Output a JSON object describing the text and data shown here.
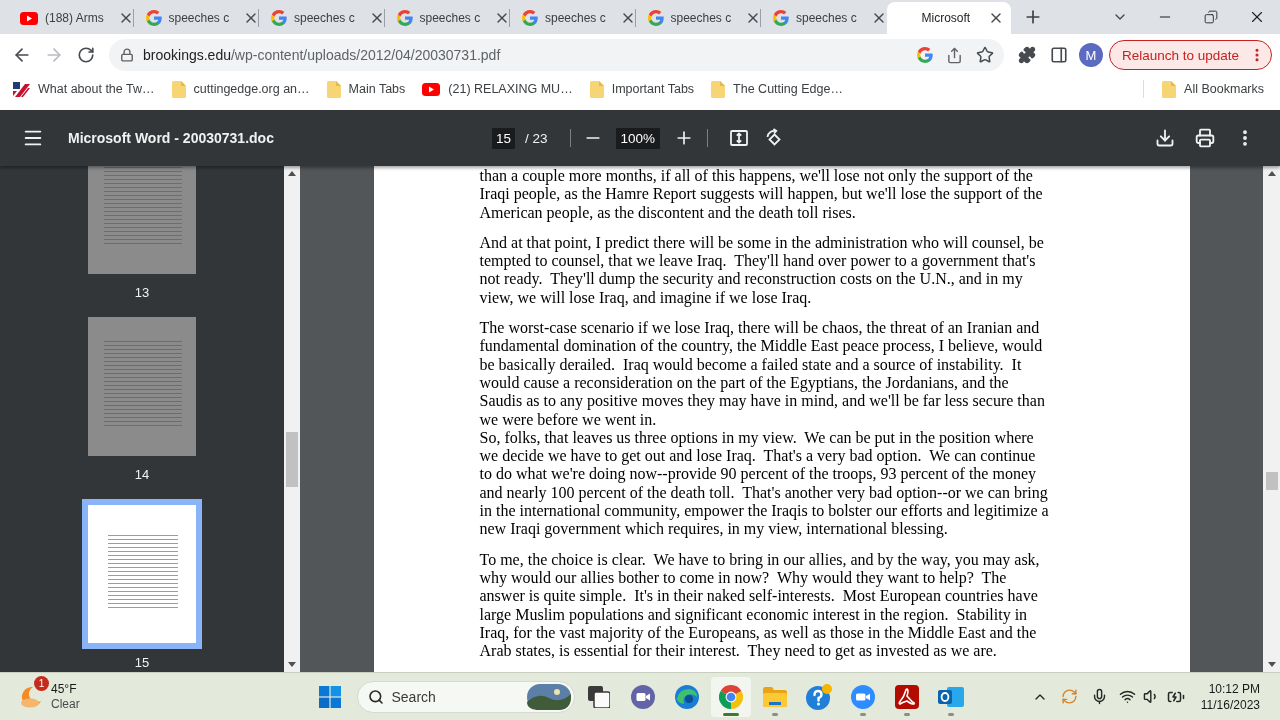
{
  "browser": {
    "tabs": [
      {
        "title": "(188) Arms",
        "kind": "video",
        "selected": false
      },
      {
        "title": "speeches c",
        "kind": "search",
        "selected": false
      },
      {
        "title": "speeches c",
        "kind": "search",
        "selected": false
      },
      {
        "title": "speeches c",
        "kind": "search",
        "selected": false
      },
      {
        "title": "speeches c",
        "kind": "search",
        "selected": false
      },
      {
        "title": "speeches c",
        "kind": "search",
        "selected": false
      },
      {
        "title": "speeches c",
        "kind": "search",
        "selected": false
      },
      {
        "title": "Microsoft",
        "kind": "blank",
        "selected": true
      }
    ],
    "nav_buttons": [
      {
        "kind": "back",
        "disabled": false
      },
      {
        "kind": "forward",
        "disabled": true
      },
      {
        "kind": "reload",
        "disabled": false
      }
    ],
    "address": {
      "host": "brookings.edu",
      "path": "/wp-content/uploads/2012/04/20030731.pdf"
    },
    "profile_initial": "M",
    "relaunch_button": "Relaunch to update",
    "bookmarks": [
      {
        "label": "What about the Tw…",
        "kind": "flag"
      },
      {
        "label": "cuttingedge.org an…",
        "kind": "folder"
      },
      {
        "label": "Main Tabs",
        "kind": "folder"
      },
      {
        "label": "(21) RELAXING MU…",
        "kind": "video"
      },
      {
        "label": "Important Tabs",
        "kind": "folder"
      },
      {
        "label": "The Cutting Edge…",
        "kind": "folder"
      }
    ],
    "all_bookmarks": "All Bookmarks"
  },
  "pdf_viewer": {
    "title": "Microsoft Word - 20030731.doc",
    "page_input": "15",
    "page_total": "/ 23",
    "zoom": "100%",
    "thumbnails": [
      {
        "label": "13",
        "selected": false
      },
      {
        "label": "14",
        "selected": false
      },
      {
        "label": "15",
        "selected": true
      }
    ],
    "paragraphs": [
      {
        "lines": [
          "than a couple more months, if all of this happens, we'll lose not only the support of the",
          "Iraqi people, as the Hamre Report suggests will happen, but we'll lose the support of the",
          "American people, as the discontent and the death toll rises."
        ]
      },
      {
        "lines": [
          "And at that point, I predict there will be some in the administration who will counsel, be",
          "tempted to counsel, that we leave Iraq.  They'll hand over power to a government that's",
          "not ready.  They'll dump the security and reconstruction costs on the U.N., and in my",
          "view, we will lose Iraq, and imagine if we lose Iraq."
        ]
      },
      {
        "lines": [
          "The worst-case scenario if we lose Iraq, there will be chaos, the threat of an Iranian and",
          "fundamental domination of the country, the Middle East peace process, I believe, would",
          "be basically derailed.  Iraq would become a failed state and a source of instability.  It",
          "would cause a reconsideration on the part of the Egyptians, the Jordanians, and the",
          "Saudis as to any positive moves they may have in mind, and we'll be far less secure than",
          "we were before we went in.",
          "So, folks, that leaves us three options in my view.  We can be put in the position where",
          "we decide we have to get out and lose Iraq.  That's a very bad option.  We can continue",
          "to do what we're doing now--provide 90 percent of the troops, 93 percent of the money",
          "and nearly 100 percent of the death toll.  That's another very bad option--or we can bring",
          "in the international community, empower the Iraqis to bolster our efforts and legitimize a",
          "new Iraqi government which requires, in my view, international blessing."
        ]
      },
      {
        "lines": [
          "To me, the choice is clear.  We have to bring in our allies, and by the way, you may ask,",
          "why would our allies bother to come in now?  Why would they want to help?  The",
          "answer is quite simple.  It's in their naked self-interests.  Most European countries have",
          "large Muslim populations and significant economic interest in the region.  Stability in",
          "Iraq, for the vast majority of the Europeans, as well as those in the Middle East and the",
          "Arab states, is essential for their interest.  They need to get as invested as we are."
        ]
      }
    ]
  },
  "taskbar": {
    "weather": {
      "badge": "1",
      "temperature": "45°F",
      "condition": "Clear"
    },
    "search_label": "Search",
    "apps": [
      {
        "kind": "task-view",
        "running": false,
        "selected": false
      },
      {
        "kind": "meet",
        "running": false,
        "selected": false
      },
      {
        "kind": "edge",
        "running": false,
        "selected": false
      },
      {
        "kind": "chrome",
        "running": true,
        "selected": true
      },
      {
        "kind": "explorer",
        "running": true,
        "selected": false
      },
      {
        "kind": "tips",
        "running": false,
        "selected": false
      },
      {
        "kind": "zoom",
        "running": true,
        "selected": false
      },
      {
        "kind": "acrobat",
        "running": true,
        "selected": false
      },
      {
        "kind": "outlook",
        "running": true,
        "selected": false
      }
    ],
    "time": "10:12 PM",
    "date": "11/16/2023"
  }
}
